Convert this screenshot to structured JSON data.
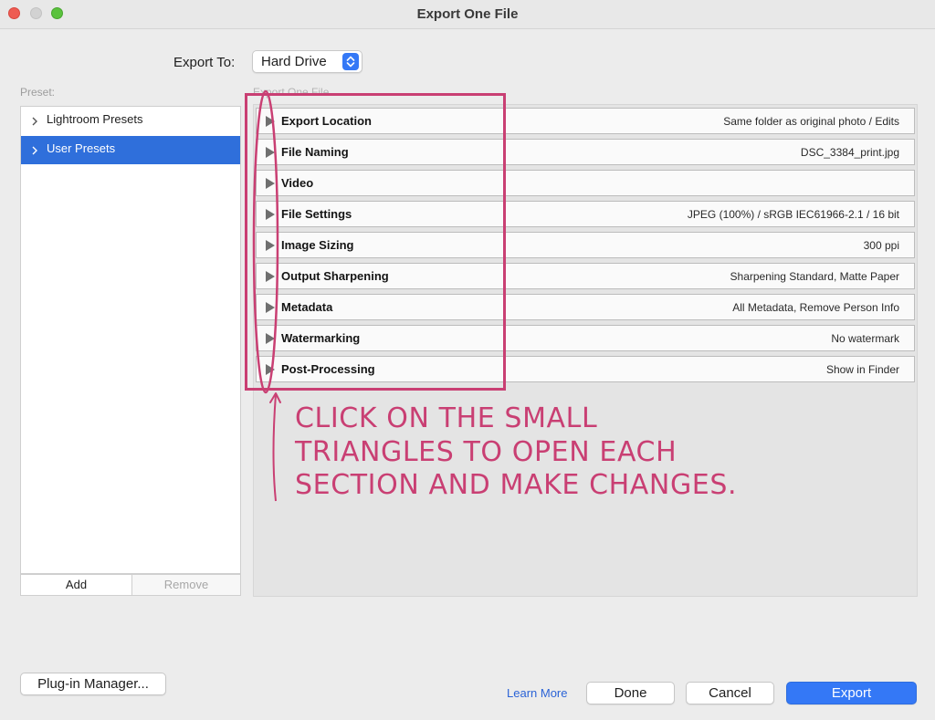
{
  "window": {
    "title": "Export One File"
  },
  "export_to": {
    "label": "Export To:",
    "value": "Hard Drive"
  },
  "presets": {
    "heading": "Preset:",
    "items": [
      {
        "label": "Lightroom Presets",
        "selected": false
      },
      {
        "label": "User Presets",
        "selected": true
      }
    ],
    "add_label": "Add",
    "remove_label": "Remove"
  },
  "sections": {
    "heading": "Export One File",
    "items": [
      {
        "name": "Export Location",
        "summary": "Same folder as original photo / Edits"
      },
      {
        "name": "File Naming",
        "summary": "DSC_3384_print.jpg"
      },
      {
        "name": "Video",
        "summary": ""
      },
      {
        "name": "File Settings",
        "summary": "JPEG (100%) / sRGB IEC61966-2.1 / 16 bit"
      },
      {
        "name": "Image Sizing",
        "summary": "300 ppi"
      },
      {
        "name": "Output Sharpening",
        "summary": "Sharpening Standard, Matte Paper"
      },
      {
        "name": "Metadata",
        "summary": "All Metadata, Remove Person Info"
      },
      {
        "name": "Watermarking",
        "summary": "No watermark"
      },
      {
        "name": "Post-Processing",
        "summary": "Show in Finder"
      }
    ]
  },
  "annotation": {
    "lines": [
      "CLICK ON THE SMALL",
      "TRIANGLES TO OPEN EACH",
      "SECTION AND MAKE CHANGES."
    ],
    "color": "#c93f73"
  },
  "footer": {
    "plugin_manager_label": "Plug-in Manager...",
    "learn_more_label": "Learn More",
    "done_label": "Done",
    "cancel_label": "Cancel",
    "export_label": "Export"
  },
  "colors": {
    "accent": "#3478f6",
    "selection": "#2f6fdb",
    "link": "#2b63d6",
    "close": "#ee5b52",
    "maximize": "#5ac23d"
  },
  "icons": {
    "disclosure": "disclosure-triangle-icon",
    "chevron": "chevron-right-icon",
    "stepper": "up-down-stepper-icon"
  }
}
